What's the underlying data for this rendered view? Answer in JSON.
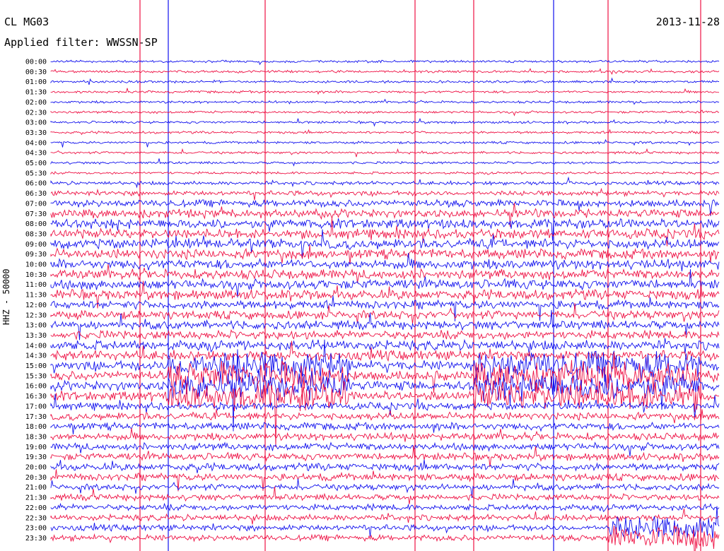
{
  "header": {
    "station": "CL MG03",
    "filter": "Applied filter: WWSSN-SP",
    "date": "2013-11-28"
  },
  "colors": {
    "even": "#1111ee",
    "odd": "#ee1144"
  },
  "chart_data": {
    "type": "line",
    "ylabel": "HHZ - 50000",
    "row_labels": [
      "00:00",
      "00:30",
      "01:00",
      "01:30",
      "02:00",
      "02:30",
      "03:00",
      "03:30",
      "04:00",
      "04:30",
      "05:00",
      "05:30",
      "06:00",
      "06:30",
      "07:00",
      "07:30",
      "08:00",
      "08:30",
      "09:00",
      "09:30",
      "10:00",
      "10:30",
      "11:00",
      "11:30",
      "12:00",
      "12:30",
      "13:00",
      "13:30",
      "14:00",
      "14:30",
      "15:00",
      "15:30",
      "16:00",
      "16:30",
      "17:00",
      "17:30",
      "18:00",
      "18:30",
      "19:00",
      "19:30",
      "20:00",
      "20:30",
      "21:00",
      "21:30",
      "22:00",
      "22:30",
      "23:00",
      "23:30"
    ],
    "row_amplitude": [
      1,
      1,
      1,
      1,
      1,
      1,
      1,
      1,
      1,
      1,
      1,
      1,
      1.5,
      2,
      3,
      3.5,
      4,
      4,
      4,
      4,
      4,
      4,
      4,
      4,
      3.5,
      3.5,
      3.5,
      3.5,
      4,
      4,
      4,
      4,
      4,
      4,
      3,
      3,
      3,
      3,
      3,
      3,
      3,
      3,
      2.5,
      2.5,
      2.5,
      2.5,
      2.5,
      2.5
    ],
    "grid": false
  }
}
